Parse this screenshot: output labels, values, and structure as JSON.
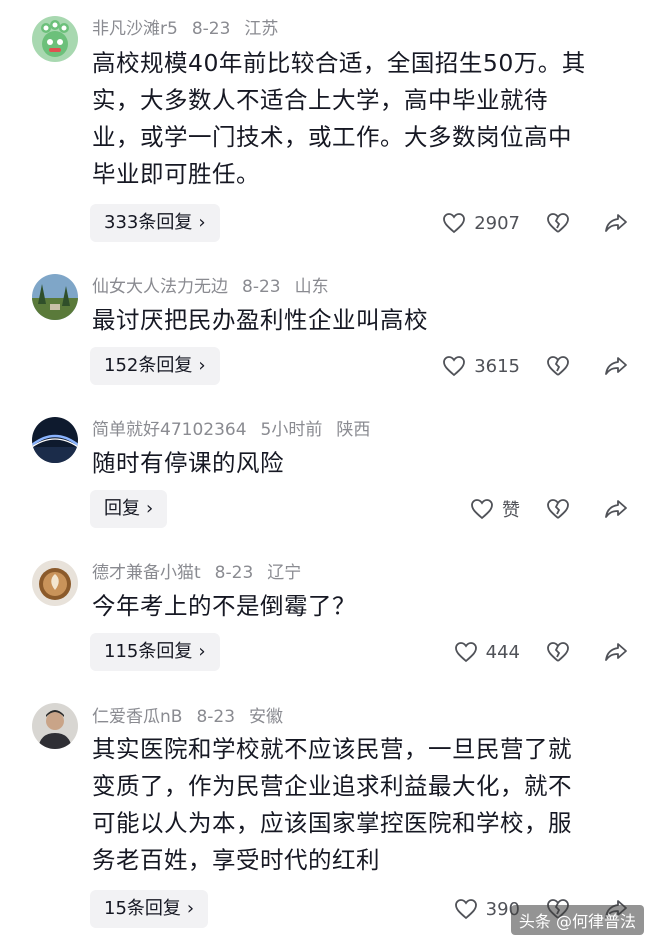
{
  "comments": [
    {
      "username": "非凡沙滩r5",
      "date": "8-23",
      "location": "江苏",
      "avatar": "green-cartoon-monster-avatar",
      "lines": [
        "高校规模40年前比较合适，全国招生50万。其",
        "实，大多数人不适合上大学，高中毕业就待",
        "业，或学一门技术，或工作。大多数岗位高中",
        "毕业即可胜任。"
      ],
      "reply_label": "333条回复",
      "like_count": "2907"
    },
    {
      "username": "仙女大人法力无边",
      "date": "8-23",
      "location": "山东",
      "avatar": "landscape-photo-avatar",
      "lines": [
        "最讨厌把民办盈利性企业叫高校"
      ],
      "reply_label": "152条回复",
      "like_count": "3615"
    },
    {
      "username": "简单就好47102364",
      "date": "5小时前",
      "location": "陕西",
      "avatar": "night-bridge-avatar",
      "lines": [
        "随时有停课的风险"
      ],
      "reply_label": "回复",
      "like_count": "赞"
    },
    {
      "username": "德才兼备小猫t",
      "date": "8-23",
      "location": "辽宁",
      "avatar": "latte-art-avatar",
      "lines": [
        "今年考上的不是倒霉了？"
      ],
      "reply_label": "115条回复",
      "like_count": "444"
    },
    {
      "username": "仁爱香瓜nB",
      "date": "8-23",
      "location": "安徽",
      "avatar": "person-photo-avatar",
      "lines": [
        "其实医院和学校就不应该民营，一旦民营了就",
        "变质了，作为民营企业追求利益最大化，就不",
        "可能以人为本，应该国家掌控医院和学校，服",
        "务老百姓，享受时代的红利"
      ],
      "reply_label": "15条回复",
      "like_count": "390"
    }
  ],
  "icons": {
    "like": "heart-outline-icon",
    "dislike": "broken-heart-icon",
    "share": "share-arrow-icon",
    "reply_chevron": "chevron-right-icon"
  },
  "watermark": "头条 @何律普法"
}
